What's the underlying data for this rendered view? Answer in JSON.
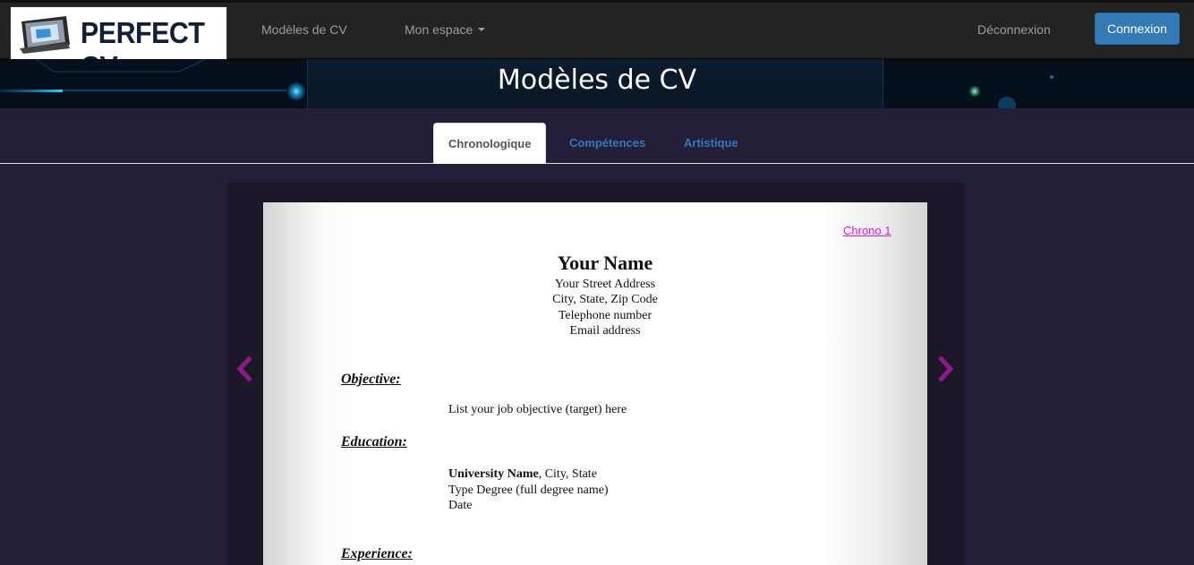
{
  "navbar": {
    "logo_text": "PERFECT CV",
    "links": [
      "Modèles de CV",
      "Mon espace"
    ],
    "logout_label": "Déconnexion",
    "login_label": "Connexion"
  },
  "banner": {
    "title": "Modèles de CV"
  },
  "tabs": [
    "Chronologique",
    "Compétences",
    "Artistique"
  ],
  "document": {
    "template_link": "Chrono 1",
    "name": "Your Name",
    "address_lines": [
      "Your Street Address",
      "City, State, Zip Code",
      "Telephone number",
      "Email address"
    ],
    "sections": {
      "objective": {
        "heading": "Objective:",
        "text": "List your job objective (target) here"
      },
      "education": {
        "heading": "Education:",
        "university_bold": "University Name",
        "university_rest": ", City, State",
        "degree": "Type Degree (full degree name)",
        "date": "Date"
      },
      "experience": {
        "heading": "Experience:"
      }
    }
  },
  "colors": {
    "accent_blue": "#337ab7",
    "arrow_purple": "#8b1a8b",
    "link_pink": "#d61ad6"
  },
  "icons": {
    "prev": "chevron-left-icon",
    "next": "chevron-right-icon",
    "dropdown": "caret-down-icon"
  }
}
